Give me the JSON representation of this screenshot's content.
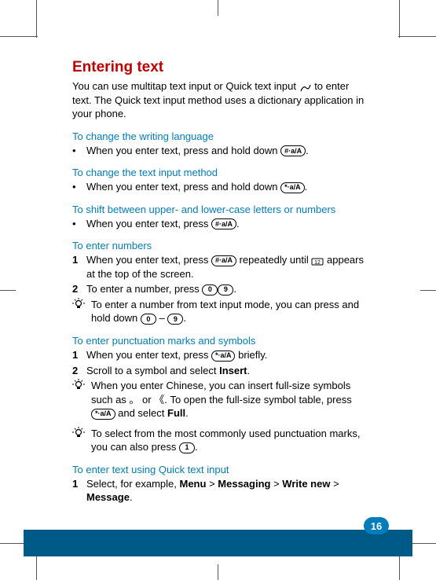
{
  "title": "Entering text",
  "intro_a": "You can use multitap text input or Quick text input ",
  "intro_b": " to enter text. The Quick text input method uses a dictionary application in your phone.",
  "sec1": {
    "head": "To change the writing language",
    "b1a": "When you enter text, press and hold down ",
    "b1b": "."
  },
  "sec2": {
    "head": "To change the text input method",
    "b1a": "When you enter text, press and hold down ",
    "b1b": "."
  },
  "sec3": {
    "head": "To shift between upper- and lower-case letters or numbers",
    "b1a": "When you enter text, press ",
    "b1b": "."
  },
  "sec4": {
    "head": "To enter numbers",
    "n1a": "When you enter text, press ",
    "n1b": " repeatedly until ",
    "n1c": " appears at the top of the screen.",
    "n2a": "To enter a number, press ",
    "n2b": "."
  },
  "tip1": {
    "a": "To enter a number from text input mode, you can press and hold down ",
    "dash": " – ",
    "b": "."
  },
  "sec5": {
    "head": "To enter punctuation marks and symbols",
    "n1a": "When you enter text, press ",
    "n1b": " briefly.",
    "n2a": "Scroll to a symbol and select ",
    "n2b": "Insert",
    "n2c": "."
  },
  "tip2": {
    "a": "When you enter Chinese, you can insert full-size symbols such as ",
    "s1": "。",
    "mid": " or ",
    "s2": "《. ",
    "b": "To open the full-size symbol table, press ",
    "c": " and select ",
    "d": "Full",
    "e": "."
  },
  "tip3": {
    "a": "To select from the most commonly used punctuation marks, you can also press ",
    "b": "."
  },
  "sec6": {
    "head": "To enter text using Quick text input",
    "n1a": "Select, for example, ",
    "m": "Menu",
    "g1": " > ",
    "ms": "Messaging",
    "g2": " > ",
    "wn": "Write new",
    "g3": " > ",
    "msg": "Message",
    "end": "."
  },
  "keys": {
    "hash": "#·a/A",
    "star": "*·a/A",
    "zero": "0",
    "nine": "9",
    "one": "1",
    "zeronine": "0  9"
  },
  "page_number": "16"
}
